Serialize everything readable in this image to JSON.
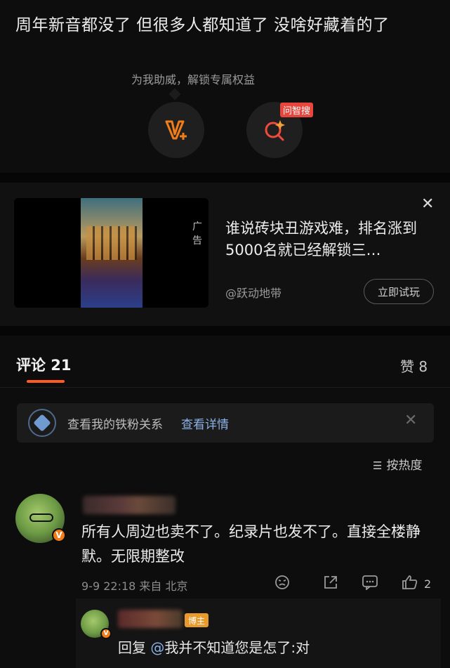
{
  "post": {
    "text": "周年新音都没了 但很多人都知道了 没啥好藏着的了"
  },
  "boost": {
    "hint": "为我助威，解锁专属权益",
    "qa_badge": "问智搜"
  },
  "ad": {
    "tag": "广告",
    "title": "谁说砖块丑游戏难，排名涨到5000名就已经解锁三…",
    "source": "@跃动地带",
    "cta": "立即试玩",
    "close_icon": "close-icon"
  },
  "tabs": {
    "comments": "评论 21",
    "likes": "赞 8"
  },
  "fan_bar": {
    "text": "查看我的铁粉关系",
    "link": "查看详情"
  },
  "sort": {
    "label": "按热度"
  },
  "comment": {
    "text": "所有人周边也卖不了。纪录片也发不了。直接全楼静默。无限期整改",
    "meta": "9-9 22:18  来自 北京",
    "like_count": "2",
    "verified": "V"
  },
  "reply": {
    "badge": "博主",
    "prefix": "回复",
    "mention": "@",
    "text": "我并不知道您是怎了:对"
  },
  "colors": {
    "accent": "#ff5a1f",
    "link": "#8ab2e6",
    "background": "#0d0d0d"
  }
}
